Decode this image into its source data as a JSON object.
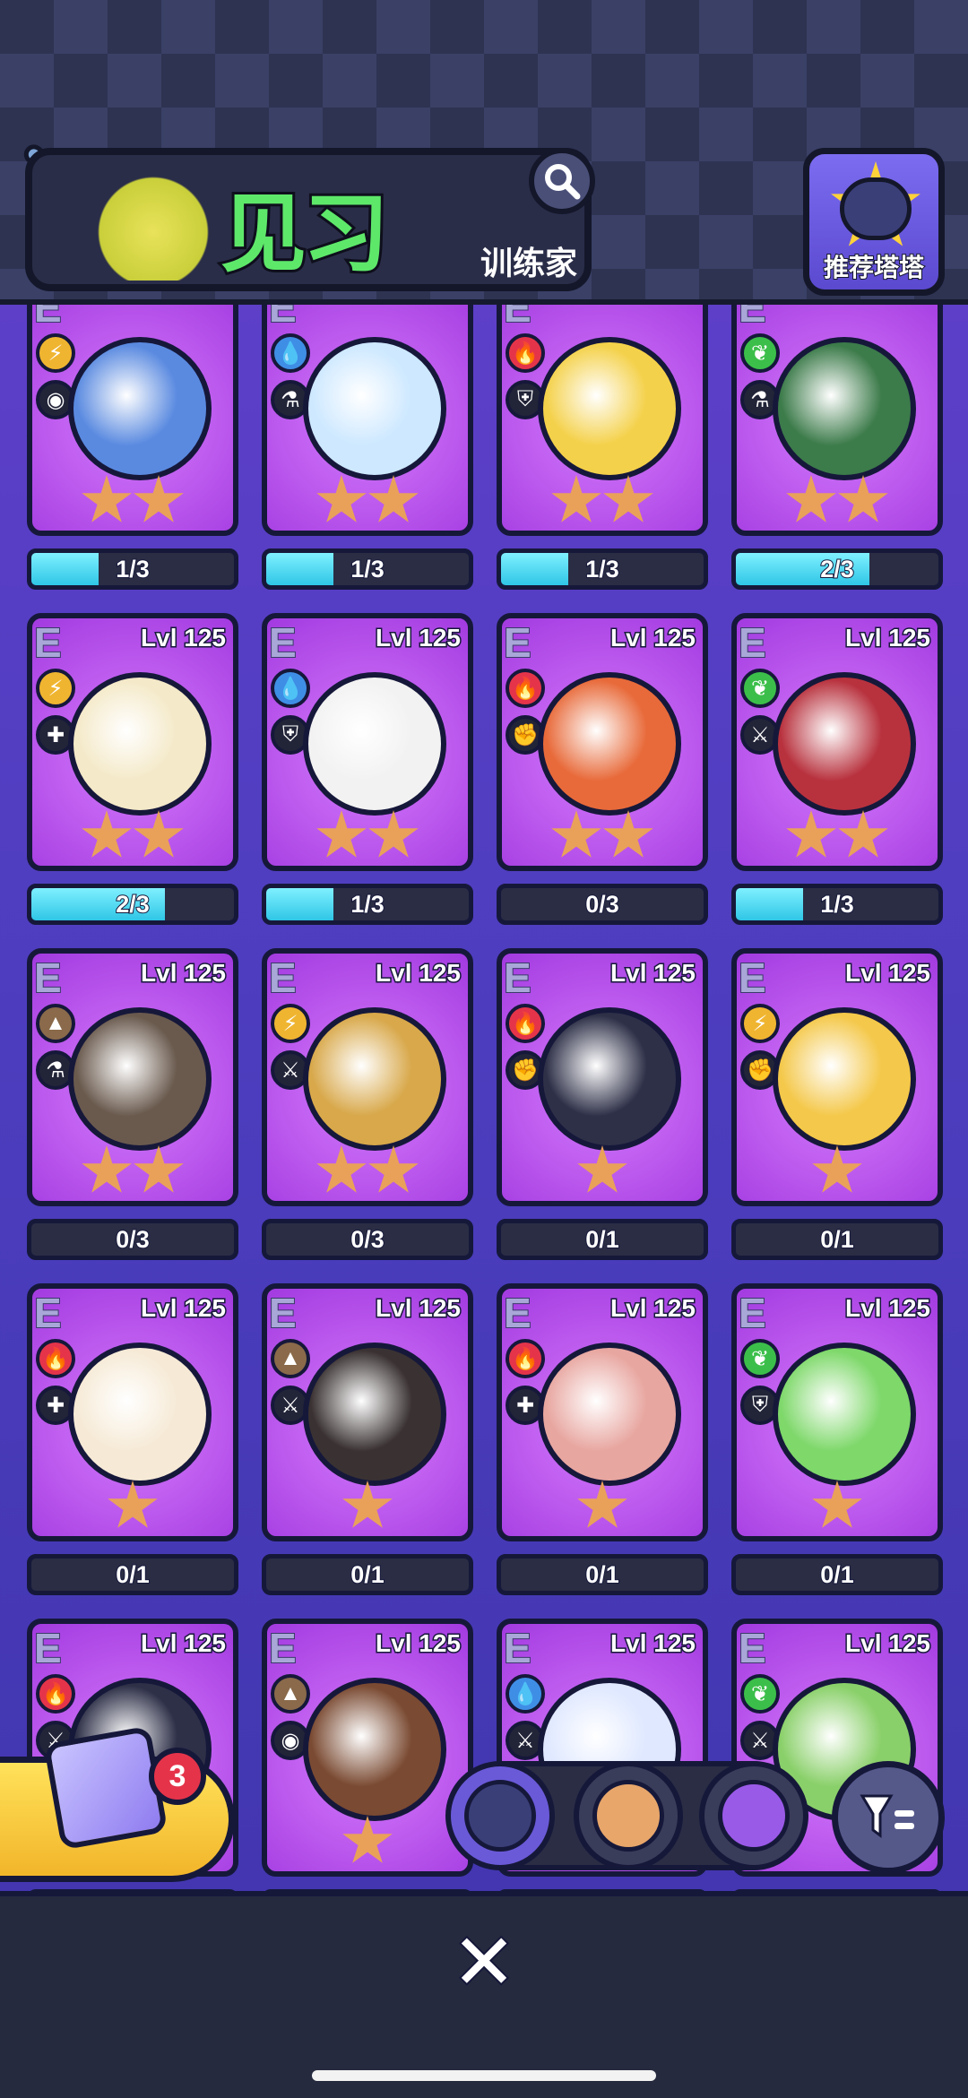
{
  "header": {
    "title": "见习",
    "subtitle": "训练家",
    "recommend_label": "推荐塔塔"
  },
  "cards": [
    {
      "grade": "E",
      "level": "",
      "element": "electric",
      "role": "eye",
      "color": "#f0b530",
      "creature": "#5a8ae0",
      "stars": 2,
      "progress": "1/3",
      "fill": 0.33
    },
    {
      "grade": "E",
      "level": "",
      "element": "water",
      "role": "flask",
      "color": "#3f8ee6",
      "creature": "#cde8ff",
      "stars": 2,
      "progress": "1/3",
      "fill": 0.33
    },
    {
      "grade": "E",
      "level": "",
      "element": "fire",
      "role": "shield",
      "color": "#e5344a",
      "creature": "#f4d14a",
      "stars": 2,
      "progress": "1/3",
      "fill": 0.33
    },
    {
      "grade": "E",
      "level": "",
      "element": "grass",
      "role": "flask",
      "color": "#3cbf4a",
      "creature": "#3c7b4a",
      "stars": 2,
      "progress": "2/3",
      "fill": 0.66
    },
    {
      "grade": "E",
      "level": "Lvl 125",
      "element": "electric",
      "role": "plus",
      "color": "#f0b530",
      "creature": "#f4e9c8",
      "stars": 2,
      "progress": "2/3",
      "fill": 0.66
    },
    {
      "grade": "E",
      "level": "Lvl 125",
      "element": "water",
      "role": "shield",
      "color": "#3f8ee6",
      "creature": "#f2f2f2",
      "stars": 2,
      "progress": "1/3",
      "fill": 0.33
    },
    {
      "grade": "E",
      "level": "Lvl 125",
      "element": "fire",
      "role": "fist",
      "color": "#e5344a",
      "creature": "#e86a3a",
      "stars": 2,
      "progress": "0/3",
      "fill": 0
    },
    {
      "grade": "E",
      "level": "Lvl 125",
      "element": "grass",
      "role": "sword",
      "color": "#3cbf4a",
      "creature": "#b8323e",
      "stars": 2,
      "progress": "1/3",
      "fill": 0.33
    },
    {
      "grade": "E",
      "level": "Lvl 125",
      "element": "earth",
      "role": "flask",
      "color": "#8a6a4a",
      "creature": "#6a5a4e",
      "stars": 2,
      "progress": "0/3",
      "fill": 0
    },
    {
      "grade": "E",
      "level": "Lvl 125",
      "element": "electric",
      "role": "sword",
      "color": "#f0b530",
      "creature": "#d8a84a",
      "stars": 2,
      "progress": "0/3",
      "fill": 0
    },
    {
      "grade": "E",
      "level": "Lvl 125",
      "element": "fire",
      "role": "fist",
      "color": "#e5344a",
      "creature": "#2e3048",
      "stars": 1,
      "progress": "0/1",
      "fill": 0
    },
    {
      "grade": "E",
      "level": "Lvl 125",
      "element": "electric",
      "role": "fist",
      "color": "#f0b530",
      "creature": "#f4c84a",
      "stars": 1,
      "progress": "0/1",
      "fill": 0
    },
    {
      "grade": "E",
      "level": "Lvl 125",
      "element": "fire",
      "role": "plus",
      "color": "#e5344a",
      "creature": "#f6ead6",
      "stars": 1,
      "progress": "0/1",
      "fill": 0
    },
    {
      "grade": "E",
      "level": "Lvl 125",
      "element": "earth",
      "role": "sword",
      "color": "#8a6a4a",
      "creature": "#3a3232",
      "stars": 1,
      "progress": "0/1",
      "fill": 0
    },
    {
      "grade": "E",
      "level": "Lvl 125",
      "element": "fire",
      "role": "plus",
      "color": "#e5344a",
      "creature": "#e8a6a0",
      "stars": 1,
      "progress": "0/1",
      "fill": 0
    },
    {
      "grade": "E",
      "level": "Lvl 125",
      "element": "grass",
      "role": "shield",
      "color": "#3cbf4a",
      "creature": "#7ed86a",
      "stars": 1,
      "progress": "0/1",
      "fill": 0
    },
    {
      "grade": "E",
      "level": "Lvl 125",
      "element": "fire",
      "role": "sword",
      "color": "#e5344a",
      "creature": "#2e3048",
      "stars": 0,
      "progress": "",
      "fill": 0
    },
    {
      "grade": "E",
      "level": "Lvl 125",
      "element": "earth",
      "role": "eye",
      "color": "#8a6a4a",
      "creature": "#7a4a32",
      "stars": 1,
      "progress": "",
      "fill": 0
    },
    {
      "grade": "E",
      "level": "Lvl 125",
      "element": "water",
      "role": "sword",
      "color": "#3f8ee6",
      "creature": "#dfe8ff",
      "stars": 0,
      "progress": "",
      "fill": 0
    },
    {
      "grade": "E",
      "level": "Lvl 125",
      "element": "grass",
      "role": "sword",
      "color": "#3cbf4a",
      "creature": "#8ad06a",
      "stars": 0,
      "progress": "",
      "fill": 0
    }
  ],
  "mystery_box": {
    "count": "3"
  },
  "tabs": [
    {
      "name": "tata",
      "color": "#6a5ad8",
      "inner": "#3a3f78"
    },
    {
      "name": "bun",
      "color": "#3a3d5a",
      "inner": "#e8a66a"
    },
    {
      "name": "shard",
      "color": "#3a3d5a",
      "inner": "#9a5ae8"
    }
  ],
  "filter_icon": "filter-icon",
  "close_icon": "close-icon"
}
